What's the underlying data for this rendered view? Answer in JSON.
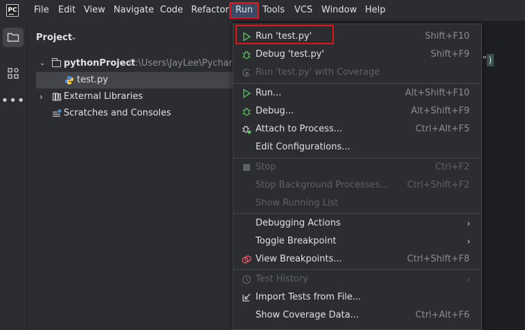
{
  "menubar": {
    "logo_text": "PC",
    "items": [
      "File",
      "Edit",
      "View",
      "Navigate",
      "Code",
      "Refactor",
      "Run",
      "Tools",
      "VCS",
      "Window",
      "Help"
    ]
  },
  "project_panel": {
    "title": "Project",
    "root_name": "pythonProject",
    "root_path": "C:\\Users\\JayLee\\Pycharm",
    "file_name": "test.py",
    "external_libraries": "External Libraries",
    "scratches": "Scratches and Consoles"
  },
  "editor": {
    "visible_snippet": "\"",
    "visible_paren": ")"
  },
  "run_menu": {
    "items": [
      {
        "label": "Run 'test.py'",
        "shortcut": "Shift+F10",
        "icon": "run-icon",
        "enabled": true
      },
      {
        "label": "Debug 'test.py'",
        "shortcut": "Shift+F9",
        "icon": "debug-icon",
        "enabled": true
      },
      {
        "label": "Run 'test.py' with Coverage",
        "shortcut": "",
        "icon": "coverage-icon",
        "enabled": false
      },
      {
        "label": "Run...",
        "shortcut": "Alt+Shift+F10",
        "icon": "run-icon",
        "enabled": true
      },
      {
        "label": "Debug...",
        "shortcut": "Alt+Shift+F9",
        "icon": "debug-icon",
        "enabled": true
      },
      {
        "label": "Attach to Process...",
        "shortcut": "Ctrl+Alt+F5",
        "icon": "attach-icon",
        "enabled": true
      },
      {
        "label": "Edit Configurations...",
        "shortcut": "",
        "icon": "",
        "enabled": true
      },
      {
        "label": "Stop",
        "shortcut": "Ctrl+F2",
        "icon": "stop-icon",
        "enabled": false
      },
      {
        "label": "Stop Background Processes...",
        "shortcut": "Ctrl+Shift+F2",
        "icon": "",
        "enabled": false
      },
      {
        "label": "Show Running List",
        "shortcut": "",
        "icon": "",
        "enabled": false
      },
      {
        "label": "Debugging Actions",
        "shortcut": "",
        "icon": "",
        "enabled": true,
        "submenu": true
      },
      {
        "label": "Toggle Breakpoint",
        "shortcut": "",
        "icon": "",
        "enabled": true,
        "submenu": true
      },
      {
        "label": "View Breakpoints...",
        "shortcut": "Ctrl+Shift+F8",
        "icon": "breakpoints-icon",
        "enabled": true
      },
      {
        "label": "Test History",
        "shortcut": "",
        "icon": "history-icon",
        "enabled": false,
        "submenu": true
      },
      {
        "label": "Import Tests from File...",
        "shortcut": "",
        "icon": "import-icon",
        "enabled": true
      },
      {
        "label": "Show Coverage Data...",
        "shortcut": "Ctrl+Alt+F6",
        "icon": "",
        "enabled": true
      }
    ]
  },
  "colors": {
    "highlight_box": "#e01515",
    "run_green": "#5fb865",
    "accent_selection": "#3d4a63"
  }
}
